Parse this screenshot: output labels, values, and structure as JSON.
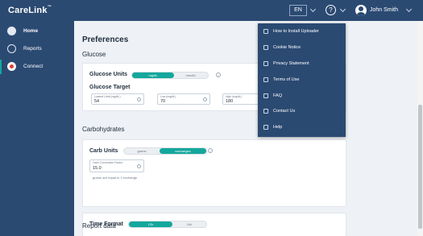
{
  "header": {
    "logo": "CareLink",
    "logo_tm": "™",
    "language": "EN",
    "help_icon": "?",
    "user_name": "John Smith"
  },
  "sidebar": {
    "items": [
      {
        "label": "Home",
        "icon": "home-icon"
      },
      {
        "label": "Reports",
        "icon": "reports-icon"
      },
      {
        "label": "Connect",
        "icon": "connect-icon"
      }
    ]
  },
  "preferences": {
    "title": "Preferences",
    "glucose": {
      "section_title": "Glucose",
      "units_label": "Glucose Units",
      "unit_options": [
        "mg/dL",
        "mmol/L"
      ],
      "selected_unit": "mg/dL",
      "target_label": "Glucose Target",
      "fields": [
        {
          "caption": "Lowest Limit (mg/dL)",
          "value": "54"
        },
        {
          "caption": "Low (mg/dL)",
          "value": "70"
        },
        {
          "caption": "High (mg/dL)",
          "value": "180"
        }
      ]
    },
    "carbs": {
      "section_title": "Carbohydrates",
      "units_label": "Carb Units",
      "unit_options": [
        "grams",
        "exchanges"
      ],
      "selected_unit": "exchanges",
      "factor_caption": "Carb Conversion Factor",
      "factor_value": "15.0",
      "factor_note": "grams are equal to 1 exchange"
    },
    "time": {
      "label": "Time Format",
      "options": [
        "12h",
        "24h"
      ],
      "selected": "12h"
    },
    "report_data_title": "Report data"
  },
  "help_menu": {
    "items": [
      {
        "label": "How to Install Uploader",
        "icon": "install-icon"
      },
      {
        "label": "Cookie Notice",
        "icon": "cookie-icon"
      },
      {
        "label": "Privacy Statement",
        "icon": "lock-icon"
      },
      {
        "label": "Terms of Use",
        "icon": "document-icon"
      },
      {
        "label": "FAQ",
        "icon": "faq-icon"
      },
      {
        "label": "Contact Us",
        "icon": "phone-icon"
      },
      {
        "label": "Help",
        "icon": "help-icon"
      }
    ]
  },
  "colors": {
    "brand_navy": "#2b4a72",
    "accent_teal": "#14a79c",
    "connect_red": "#d9423a"
  }
}
